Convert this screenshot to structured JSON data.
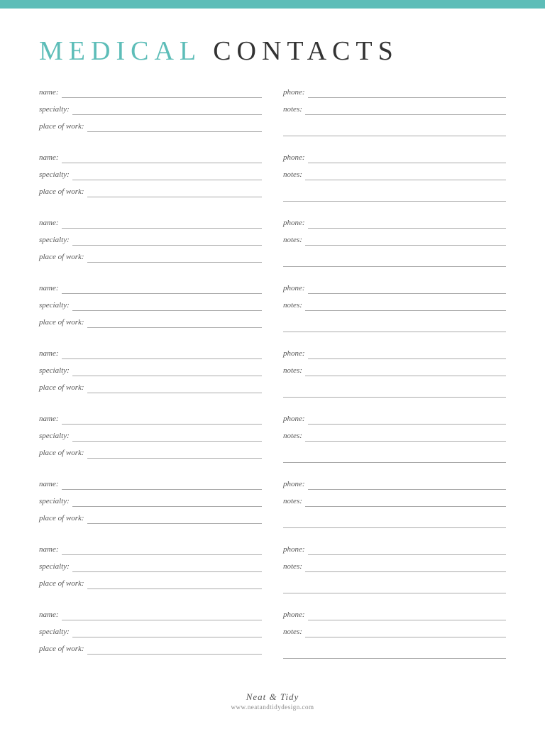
{
  "topBar": {
    "color": "#5dbdb8"
  },
  "title": {
    "part1": "MEDICAL",
    "part2": "CONTACTS"
  },
  "fields": {
    "name": "name:",
    "specialty": "specialty:",
    "placeOfWork": "place of work:",
    "phone": "phone:",
    "notes": "notes:"
  },
  "entries": [
    {
      "id": 1
    },
    {
      "id": 2
    },
    {
      "id": 3
    },
    {
      "id": 4
    },
    {
      "id": 5
    },
    {
      "id": 6
    },
    {
      "id": 7
    },
    {
      "id": 8
    },
    {
      "id": 9
    }
  ],
  "footer": {
    "brand": "Neat & Tidy",
    "url": "www.neatandtidydesign.com"
  }
}
